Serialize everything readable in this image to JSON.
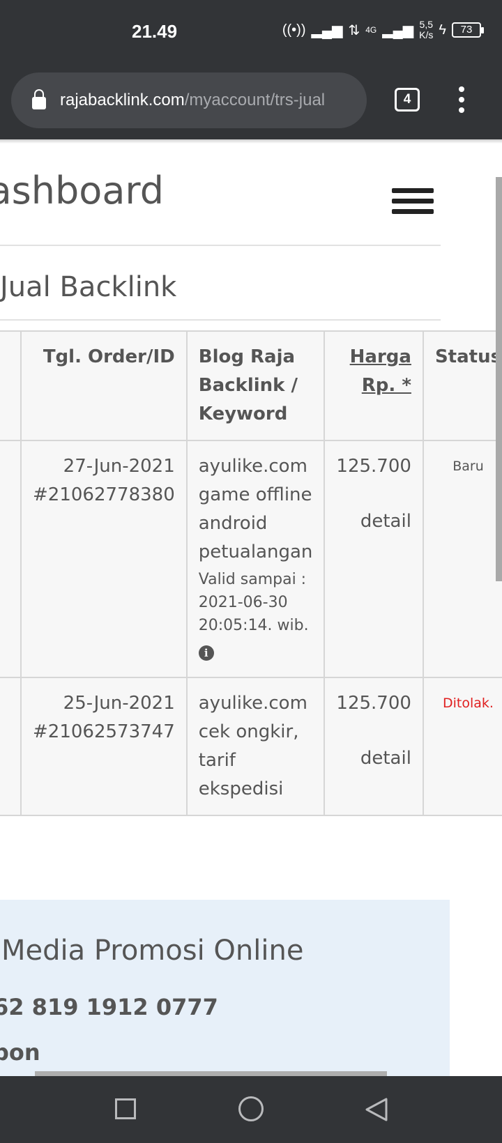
{
  "status_bar": {
    "time": "21.49",
    "network": "4G",
    "speed_value": "5,5",
    "speed_unit": "K/s",
    "battery": "73"
  },
  "browser": {
    "url_host": "rajabacklink.com",
    "url_path": "/myaccount/trs-jual",
    "tab_count": "4"
  },
  "page": {
    "dashboard_title": "Dashboard",
    "section_title": "Jual Backlink",
    "table": {
      "headers": [
        "Tgl. Order/ID",
        "Blog Raja Backlink / Keyword",
        "Harga Rp. *",
        "Status"
      ],
      "rows": [
        {
          "date": "27-Jun-2021",
          "id": "#21062778380",
          "blog": "ayulike.com",
          "keyword": "game offline android petualangan",
          "valid": "Valid sampai : 2021-06-30 20:05:14. wib.",
          "price": "125.700",
          "detail": "detail",
          "status": "Baru"
        },
        {
          "date": "25-Jun-2021",
          "id": "#21062573747",
          "blog": "ayulike.com",
          "keyword": "cek ongkir, tarif ekspedisi",
          "price": "125.700",
          "detail": "detail",
          "status": "Ditolak."
        }
      ]
    },
    "promo": {
      "title": "Media Promosi Online",
      "phone": "62 819 1912 0777",
      "extra": "bon"
    }
  },
  "colors": {
    "chrome": "#323437",
    "status_rejected": "#e02020",
    "promo_bg": "#e7f0f9"
  }
}
